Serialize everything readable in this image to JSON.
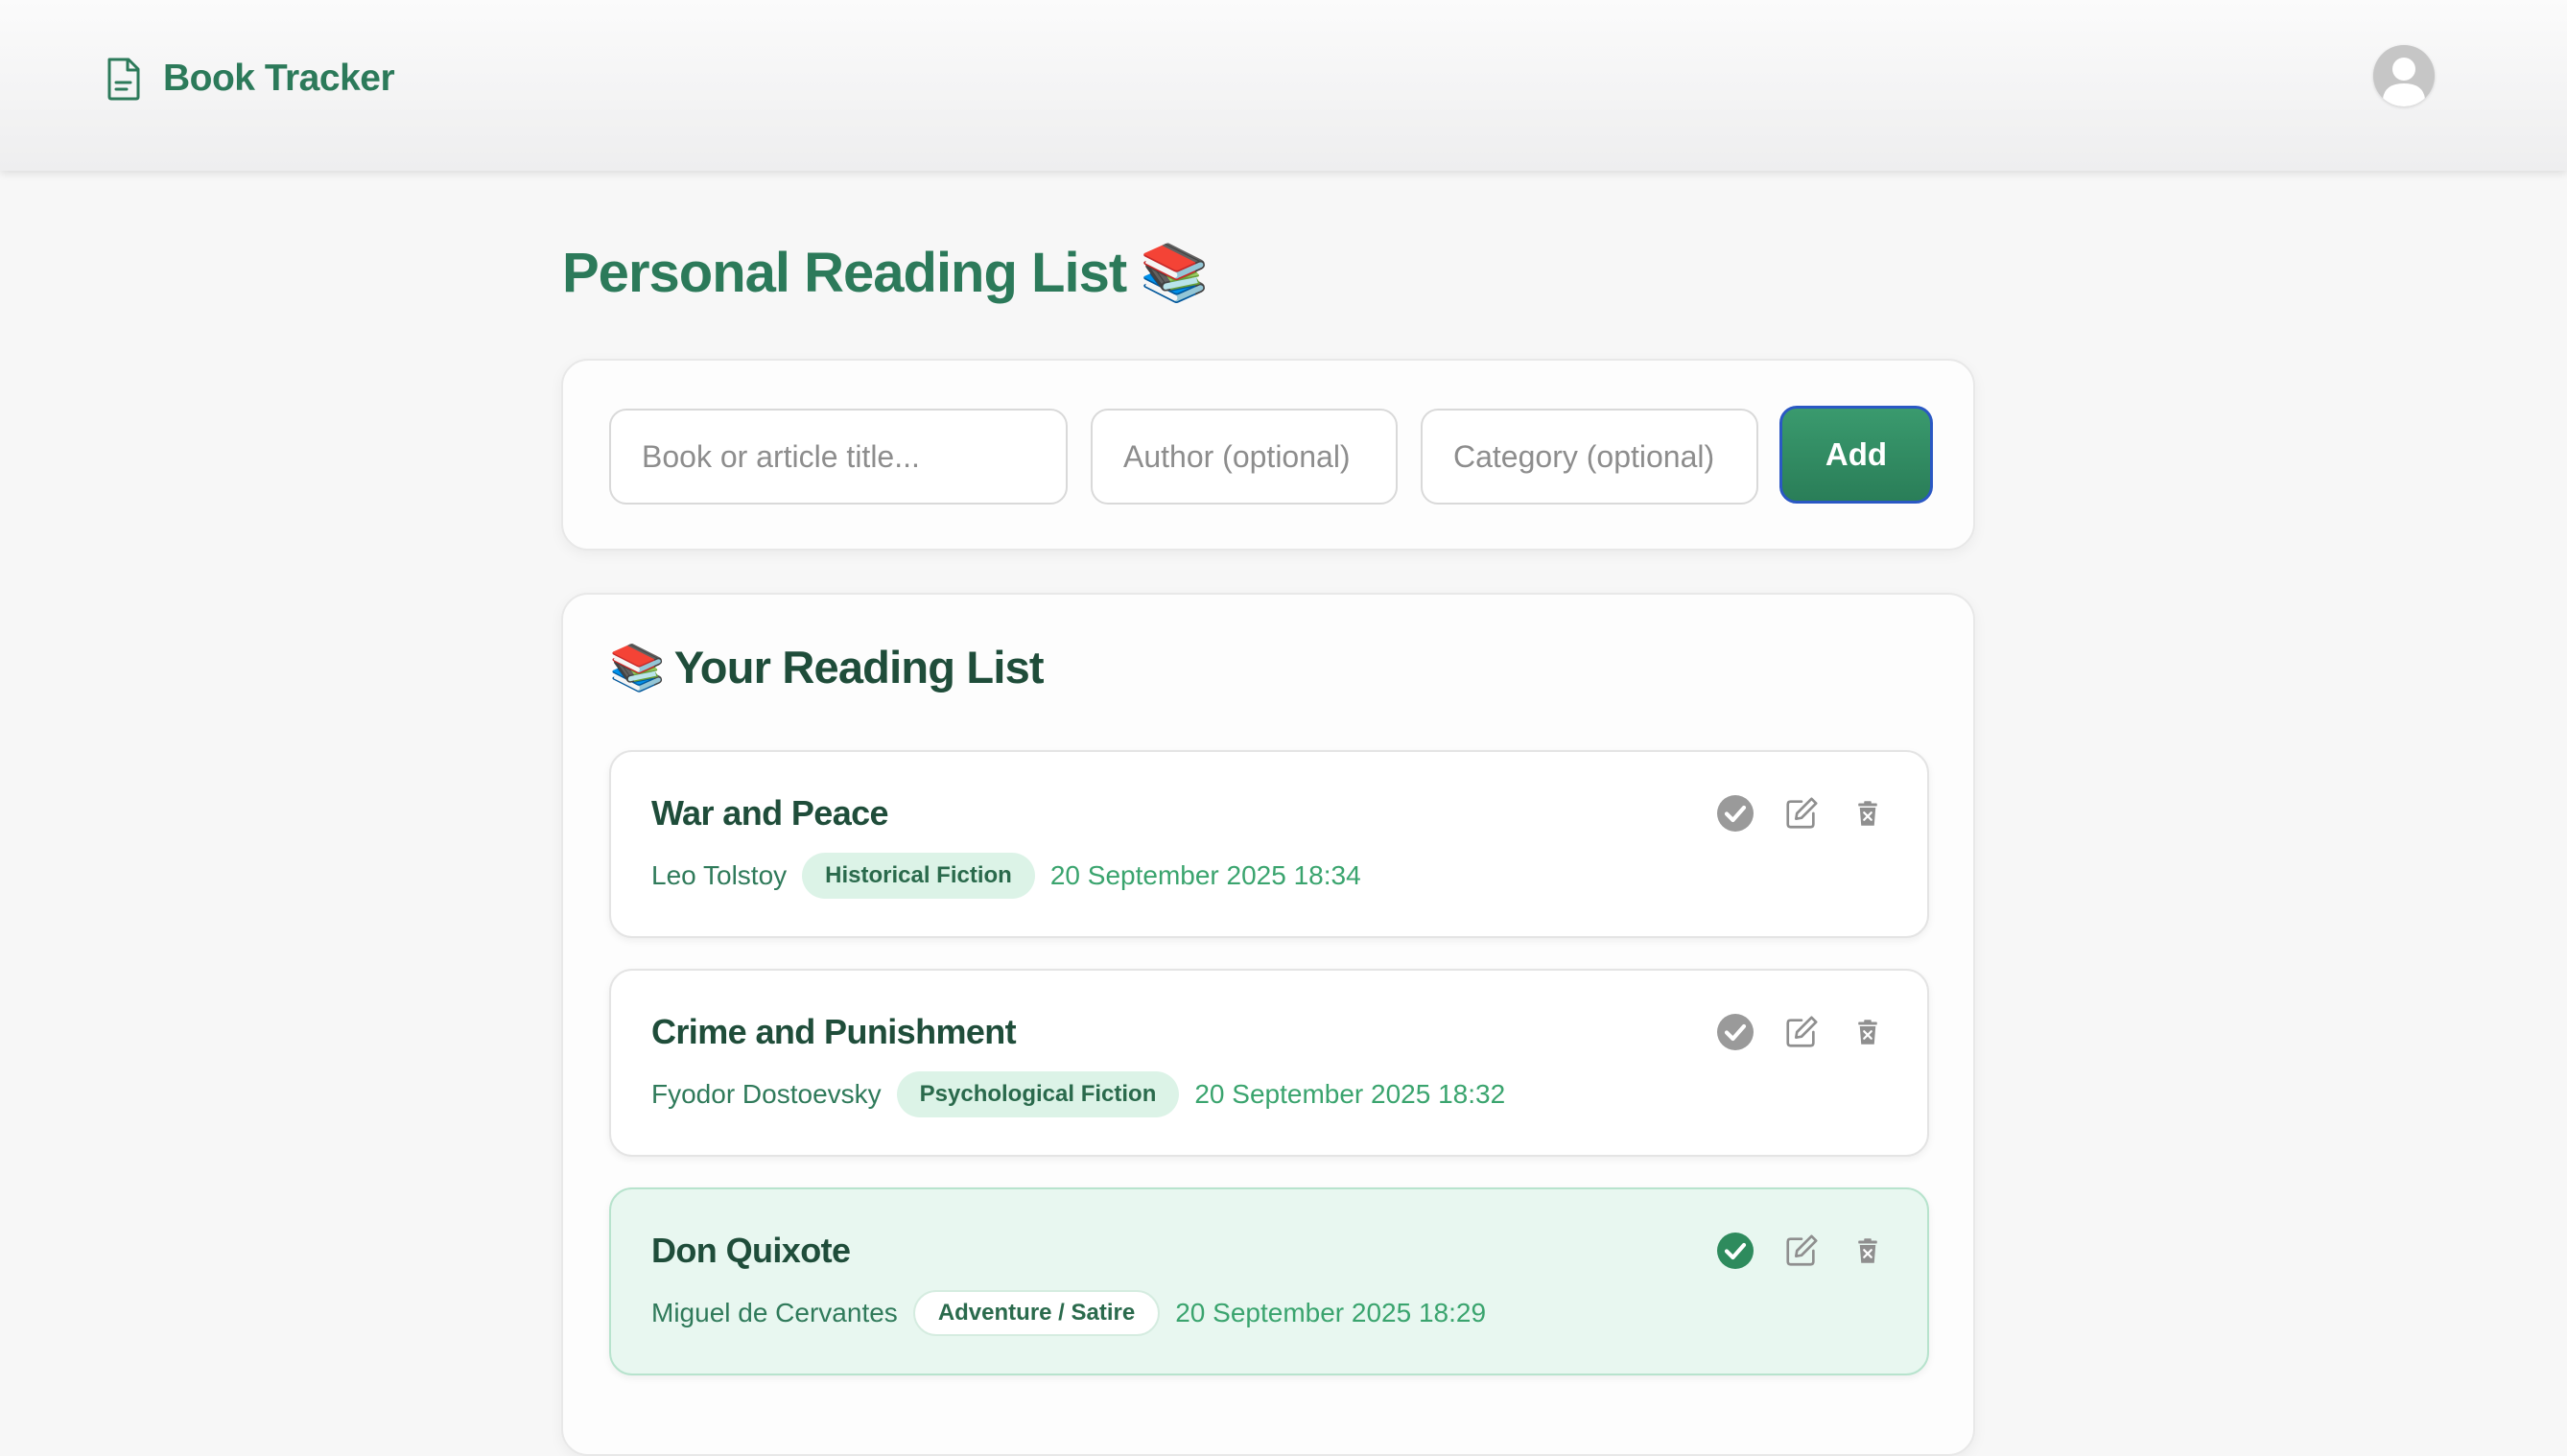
{
  "header": {
    "brand_icon": "document-icon",
    "app_title": "Book Tracker",
    "avatar_icon": "user-avatar"
  },
  "page": {
    "title": "Personal Reading List",
    "title_emoji": "📚"
  },
  "form": {
    "title_placeholder": "Book or article title...",
    "title_value": "",
    "author_placeholder": "Author (optional)",
    "author_value": "",
    "category_placeholder": "Category (optional)",
    "category_value": "",
    "add_label": "Add"
  },
  "list": {
    "heading_emoji": "📚",
    "heading": "Your Reading List",
    "items": [
      {
        "title": "War and Peace",
        "author": "Leo Tolstoy",
        "category": "Historical Fiction",
        "date": "20 September 2025 18:34",
        "done": false
      },
      {
        "title": "Crime and Punishment",
        "author": "Fyodor Dostoevsky",
        "category": "Psychological Fiction",
        "date": "20 September 2025 18:32",
        "done": false
      },
      {
        "title": "Don Quixote",
        "author": "Miguel de Cervantes",
        "category": "Adventure / Satire",
        "date": "20 September 2025 18:29",
        "done": true
      }
    ]
  },
  "icons": {
    "complete": "check-circle-icon",
    "edit": "edit-icon",
    "delete": "trash-icon"
  },
  "colors": {
    "brand": "#2c7a5a",
    "heading": "#1f4d3a",
    "date": "#3aa46e",
    "done_background": "#e8f7f0",
    "check_done": "#2e8b5d",
    "check_pending": "#9a9a9a",
    "add_button": "#2f8a61",
    "add_button_border": "#2a58c4"
  }
}
